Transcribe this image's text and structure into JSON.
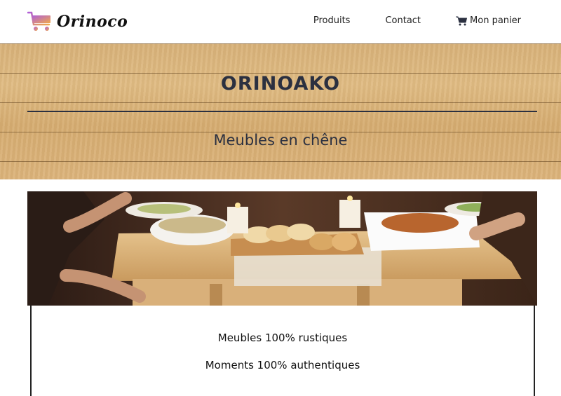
{
  "header": {
    "logo_text": "Orinoco",
    "logo_icon": "shopping-cart-icon",
    "nav": {
      "products_label": "Produits",
      "contact_label": "Contact",
      "cart_label": "Mon panier",
      "cart_icon": "cart-icon"
    }
  },
  "hero": {
    "title": "ORINOAKO",
    "subtitle": "Meubles en chêne"
  },
  "card": {
    "tagline_1": "Meubles 100% rustiques",
    "tagline_2": "Moments 100% authentiques"
  },
  "colors": {
    "logo_gradient_start": "#b05fd8",
    "logo_gradient_end": "#f0a84a",
    "heading": "#2b3040",
    "wood": "#dcb47c"
  }
}
